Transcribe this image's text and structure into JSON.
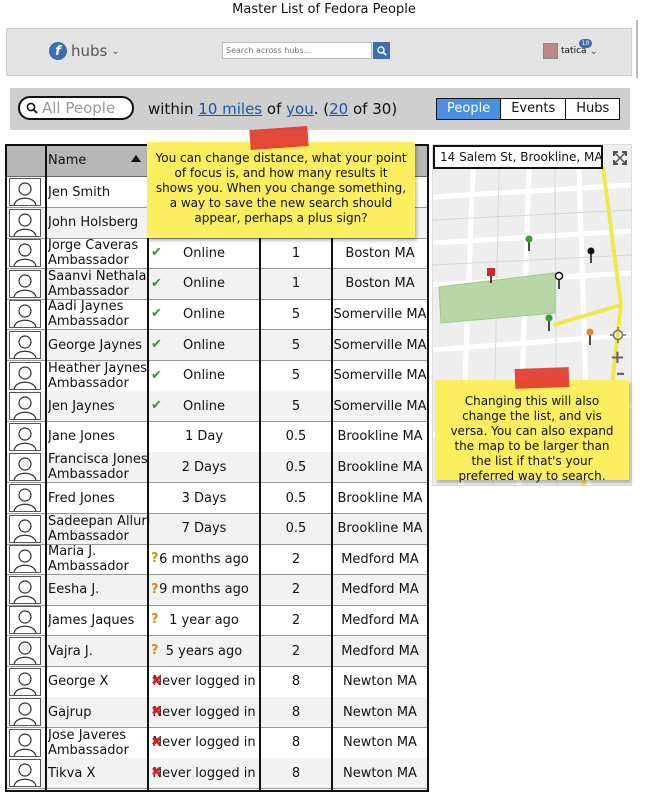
{
  "page_title": "Master List of Fedora People",
  "topbar": {
    "brand": "hubs",
    "search_placeholder": "Search across hubs...",
    "username": "tatica",
    "notification_count": "10"
  },
  "filter": {
    "search_placeholder": "All People",
    "within": "within",
    "distance": "10 miles",
    "of": "of",
    "focus": "you",
    "paren_open": ". (",
    "count": "20",
    "of_total": "of 30)",
    "tabs": [
      "People",
      "Events",
      "Hubs"
    ],
    "active_tab": "People"
  },
  "table": {
    "header_name": "Name",
    "rows": [
      {
        "name": "Jen Smith",
        "sub": "",
        "status_icon": "",
        "status": "",
        "distance": "",
        "location": ""
      },
      {
        "name": "John Holsberg",
        "sub": "",
        "status_icon": "",
        "status": "",
        "distance": "",
        "location": ""
      },
      {
        "name": "Jorge Caveras",
        "sub": "Ambassador",
        "status_icon": "check-icon",
        "status": "Online",
        "distance": "1",
        "location": "Boston MA"
      },
      {
        "name": "Saanvi Nethala",
        "sub": "Ambassador",
        "status_icon": "check-icon",
        "status": "Online",
        "distance": "1",
        "location": "Boston MA"
      },
      {
        "name": "Aadi Jaynes",
        "sub": "Ambassador",
        "status_icon": "check-icon",
        "status": "Online",
        "distance": "5",
        "location": "Somerville MA"
      },
      {
        "name": "George Jaynes",
        "sub": "",
        "status_icon": "check-icon",
        "status": "Online",
        "distance": "5",
        "location": "Somerville MA"
      },
      {
        "name": "Heather Jaynes",
        "sub": "Ambassador",
        "status_icon": "check-icon",
        "status": "Online",
        "distance": "5",
        "location": "Somerville MA"
      },
      {
        "name": "Jen Jaynes",
        "sub": "",
        "status_icon": "check-icon",
        "status": "Online",
        "distance": "5",
        "location": "Somerville MA"
      },
      {
        "name": "Jane Jones",
        "sub": "",
        "status_icon": "",
        "status": "1 Day",
        "distance": "0.5",
        "location": "Brookline MA"
      },
      {
        "name": "Francisca Jones",
        "sub": "Ambassador",
        "status_icon": "",
        "status": "2 Days",
        "distance": "0.5",
        "location": "Brookline MA"
      },
      {
        "name": "Fred Jones",
        "sub": "",
        "status_icon": "",
        "status": "3 Days",
        "distance": "0.5",
        "location": "Brookline MA"
      },
      {
        "name": "Sadeepan Alluri",
        "sub": "Ambassador",
        "status_icon": "",
        "status": "7 Days",
        "distance": "0.5",
        "location": "Brookline MA"
      },
      {
        "name": "Maria J.",
        "sub": "Ambassador",
        "status_icon": "question-icon",
        "status": "6 months ago",
        "distance": "2",
        "location": "Medford MA"
      },
      {
        "name": "Eesha J.",
        "sub": "",
        "status_icon": "question-icon",
        "status": "9 months ago",
        "distance": "2",
        "location": "Medford MA"
      },
      {
        "name": "James Jaques",
        "sub": "",
        "status_icon": "question-icon",
        "status": "1 year ago",
        "distance": "2",
        "location": "Medford MA"
      },
      {
        "name": "Vajra J.",
        "sub": "",
        "status_icon": "question-icon",
        "status": "5 years ago",
        "distance": "2",
        "location": "Medford MA"
      },
      {
        "name": "George X",
        "sub": "",
        "status_icon": "x-icon",
        "status": "Never logged in",
        "distance": "8",
        "location": "Newton MA"
      },
      {
        "name": "Gajrup",
        "sub": "",
        "status_icon": "x-icon",
        "status": "Never logged in",
        "distance": "8",
        "location": "Newton MA"
      },
      {
        "name": "Jose Javeres",
        "sub": "Ambassador",
        "status_icon": "x-icon",
        "status": "Never logged in",
        "distance": "8",
        "location": "Newton MA"
      },
      {
        "name": "Tikva X",
        "sub": "",
        "status_icon": "x-icon",
        "status": "Never logged in",
        "distance": "8",
        "location": "Newton MA"
      }
    ]
  },
  "map": {
    "address": "14 Salem St, Brookline, MA"
  },
  "notes": {
    "distance_note": "You can change distance, what your point of focus is, and how many results it shows you. When you change something, a way to save the new search should appear, perhaps a plus sign?",
    "map_note": "Changing this will also change the list, and vis versa. You can also expand the map to be larger than the list if that's your preferred way to search."
  },
  "colors": {
    "accent": "#4a8fe0",
    "link": "#1a58a6",
    "sticky": "#fbee5f",
    "online": "#2b9a2b",
    "unknown": "#e08a18",
    "never": "#d82020"
  }
}
